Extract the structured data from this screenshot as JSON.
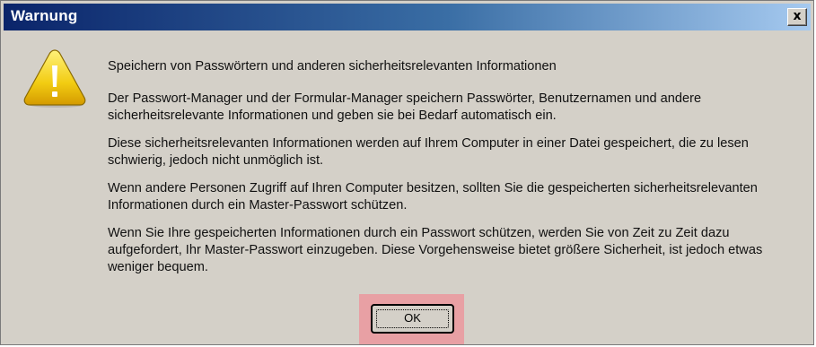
{
  "window": {
    "title": "Warnung",
    "close_label": "x"
  },
  "icon": "warning-icon",
  "message": {
    "heading": "Speichern von Passwörtern und anderen sicherheitsrelevanten Informationen",
    "paragraphs": [
      "Der Passwort-Manager und der Formular-Manager speichern Passwörter, Benutzernamen und andere sicherheitsrelevante Informationen und geben sie bei Bedarf automatisch ein.",
      "Diese sicherheitsrelevanten Informationen werden auf Ihrem Computer in einer Datei gespeichert, die zu lesen schwierig, jedoch nicht unmöglich ist.",
      "Wenn andere Personen Zugriff auf Ihren Computer besitzen, sollten Sie die gespeicherten sicherheitsrelevanten Informationen durch ein Master-Passwort schützen.",
      "Wenn Sie Ihre gespeicherten Informationen durch ein Passwort schützen, werden Sie von Zeit zu Zeit dazu aufgefordert, Ihr Master-Passwort einzugeben. Diese Vorgehensweise bietet größere Sicherheit, ist jedoch etwas weniger bequem."
    ]
  },
  "buttons": {
    "ok_label": "OK"
  },
  "colors": {
    "titlebar_start": "#0a246a",
    "titlebar_end": "#a6caf0",
    "dialog_bg": "#d4d0c8",
    "highlight": "#e8a0a4"
  }
}
